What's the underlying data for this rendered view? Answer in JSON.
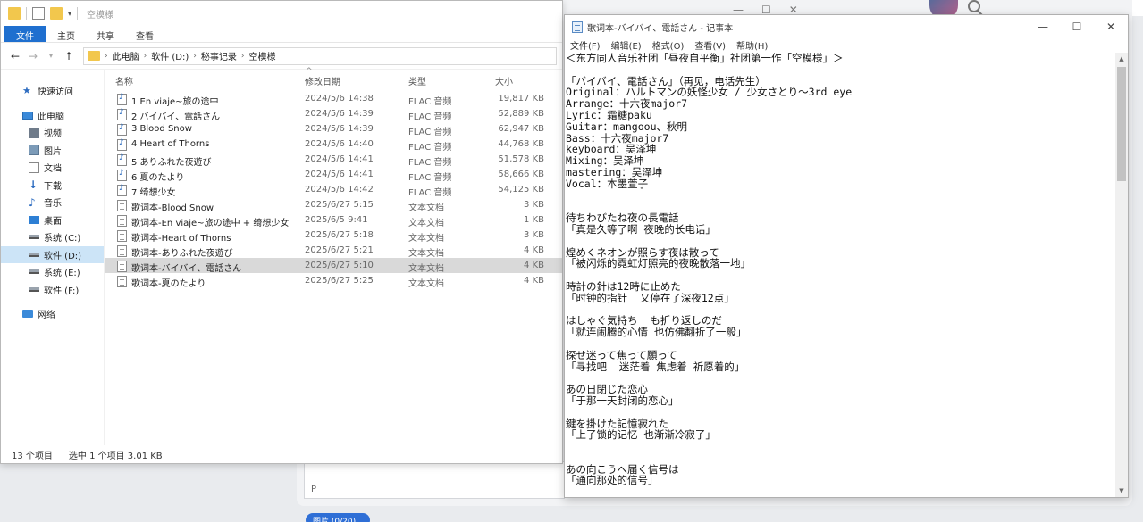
{
  "background": {
    "input_hint": "P",
    "pill_label": "图片 (0/20)"
  },
  "explorer": {
    "title": "空模様",
    "ribbon_tabs": [
      "文件",
      "主页",
      "共享",
      "查看"
    ],
    "breadcrumb": [
      "此电脑",
      "软件 (D:)",
      "秘事记录",
      "空模様"
    ],
    "nav": [
      {
        "label": "快速访问",
        "icon": "star-icon",
        "level": 0
      },
      {
        "label": "此电脑",
        "icon": "computer-icon",
        "level": 0
      },
      {
        "label": "视频",
        "icon": "video-icon",
        "level": 1
      },
      {
        "label": "图片",
        "icon": "picture-icon",
        "level": 1
      },
      {
        "label": "文档",
        "icon": "document-icon",
        "level": 1
      },
      {
        "label": "下载",
        "icon": "download-icon",
        "level": 1
      },
      {
        "label": "音乐",
        "icon": "music-icon",
        "level": 1
      },
      {
        "label": "桌面",
        "icon": "desktop-icon",
        "level": 1
      },
      {
        "label": "系统 (C:)",
        "icon": "drive-icon",
        "level": 1
      },
      {
        "label": "软件 (D:)",
        "icon": "drive-icon",
        "level": 1,
        "selected": true
      },
      {
        "label": "系统 (E:)",
        "icon": "drive-icon",
        "level": 1
      },
      {
        "label": "软件 (F:)",
        "icon": "drive-icon",
        "level": 1
      },
      {
        "label": "网络",
        "icon": "network-icon",
        "level": 0
      }
    ],
    "columns": {
      "name": "名称",
      "date": "修改日期",
      "type": "类型",
      "size": "大小"
    },
    "files": [
      {
        "name": "1 En viaje~旅の途中",
        "date": "2024/5/6 14:38",
        "type": "FLAC 音频",
        "size": "19,817 KB",
        "kind": "audio"
      },
      {
        "name": "2 バイバイ、電話さん",
        "date": "2024/5/6 14:39",
        "type": "FLAC 音频",
        "size": "52,889 KB",
        "kind": "audio"
      },
      {
        "name": "3 Blood Snow",
        "date": "2024/5/6 14:39",
        "type": "FLAC 音频",
        "size": "62,947 KB",
        "kind": "audio"
      },
      {
        "name": "4 Heart of Thorns",
        "date": "2024/5/6 14:40",
        "type": "FLAC 音频",
        "size": "44,768 KB",
        "kind": "audio"
      },
      {
        "name": "5 ありふれた夜遊び",
        "date": "2024/5/6 14:41",
        "type": "FLAC 音频",
        "size": "51,578 KB",
        "kind": "audio"
      },
      {
        "name": "6 夏のたより",
        "date": "2024/5/6 14:41",
        "type": "FLAC 音频",
        "size": "58,666 KB",
        "kind": "audio"
      },
      {
        "name": "7 绮想少女",
        "date": "2024/5/6 14:42",
        "type": "FLAC 音频",
        "size": "54,125 KB",
        "kind": "audio"
      },
      {
        "name": "歌词本-Blood Snow",
        "date": "2025/6/27 5:15",
        "type": "文本文档",
        "size": "3 KB",
        "kind": "text"
      },
      {
        "name": "歌词本-En viaje~旅の途中 + 绮想少女",
        "date": "2025/6/5 9:41",
        "type": "文本文档",
        "size": "1 KB",
        "kind": "text"
      },
      {
        "name": "歌词本-Heart of Thorns",
        "date": "2025/6/27 5:18",
        "type": "文本文档",
        "size": "3 KB",
        "kind": "text"
      },
      {
        "name": "歌词本-ありふれた夜遊び",
        "date": "2025/6/27 5:21",
        "type": "文本文档",
        "size": "4 KB",
        "kind": "text"
      },
      {
        "name": "歌词本-バイバイ、電話さん",
        "date": "2025/6/27 5:10",
        "type": "文本文档",
        "size": "4 KB",
        "kind": "text",
        "selected": true
      },
      {
        "name": "歌词本-夏のたより",
        "date": "2025/6/27 5:25",
        "type": "文本文档",
        "size": "4 KB",
        "kind": "text"
      }
    ],
    "status": {
      "count": "13 个项目",
      "selection": "选中 1 个项目  3.01 KB"
    }
  },
  "notepad": {
    "title": "歌词本-バイバイ、電話さん - 记事本",
    "menu": [
      "文件(F)",
      "编辑(E)",
      "格式(O)",
      "查看(V)",
      "帮助(H)"
    ],
    "lines": [
      "＜东方同人音乐社团「昼夜自平衡」社团第一作「空模様」＞",
      "",
      "「バイバイ、電話さん」（再见，电话先生）",
      "Original：ハルトマンの妖怪少女 / 少女さとり～3rd eye",
      "Arrange：十六夜major7",
      "Lyric：霜糖paku",
      "Guitar：mangoou、秋明",
      "Bass：十六夜major7",
      "keyboard：吴泽坤",
      "Mixing：吴泽坤",
      "mastering：吴泽坤",
      "Vocal：本墨萱子",
      "",
      "",
      "待ちわびたね夜の長電話",
      "「真是久等了啊 夜晚的长电话」",
      "",
      "煌めくネオンが照らす夜は散って",
      "「被闪烁的霓虹灯照亮的夜晚散落一地」",
      "",
      "時計の針は12時に止めた",
      "「时钟的指针  又停在了深夜12点」",
      "",
      "はしゃぐ気持ち  も折り返しのだ",
      "「就连闹腾的心情 也仿佛翻折了一般」",
      "",
      "探せ迷って焦って願って",
      "「寻找吧  迷茫着 焦虑着 祈愿着的」",
      "",
      "あの日閉じた恋心",
      "「于那一天封闭的恋心」",
      "",
      "鍵を掛けた記憶寂れた",
      "「上了锁的记忆 也渐渐冷寂了」",
      "",
      "",
      "あの向こうへ届く信号は",
      "「通向那处的信号」"
    ]
  }
}
